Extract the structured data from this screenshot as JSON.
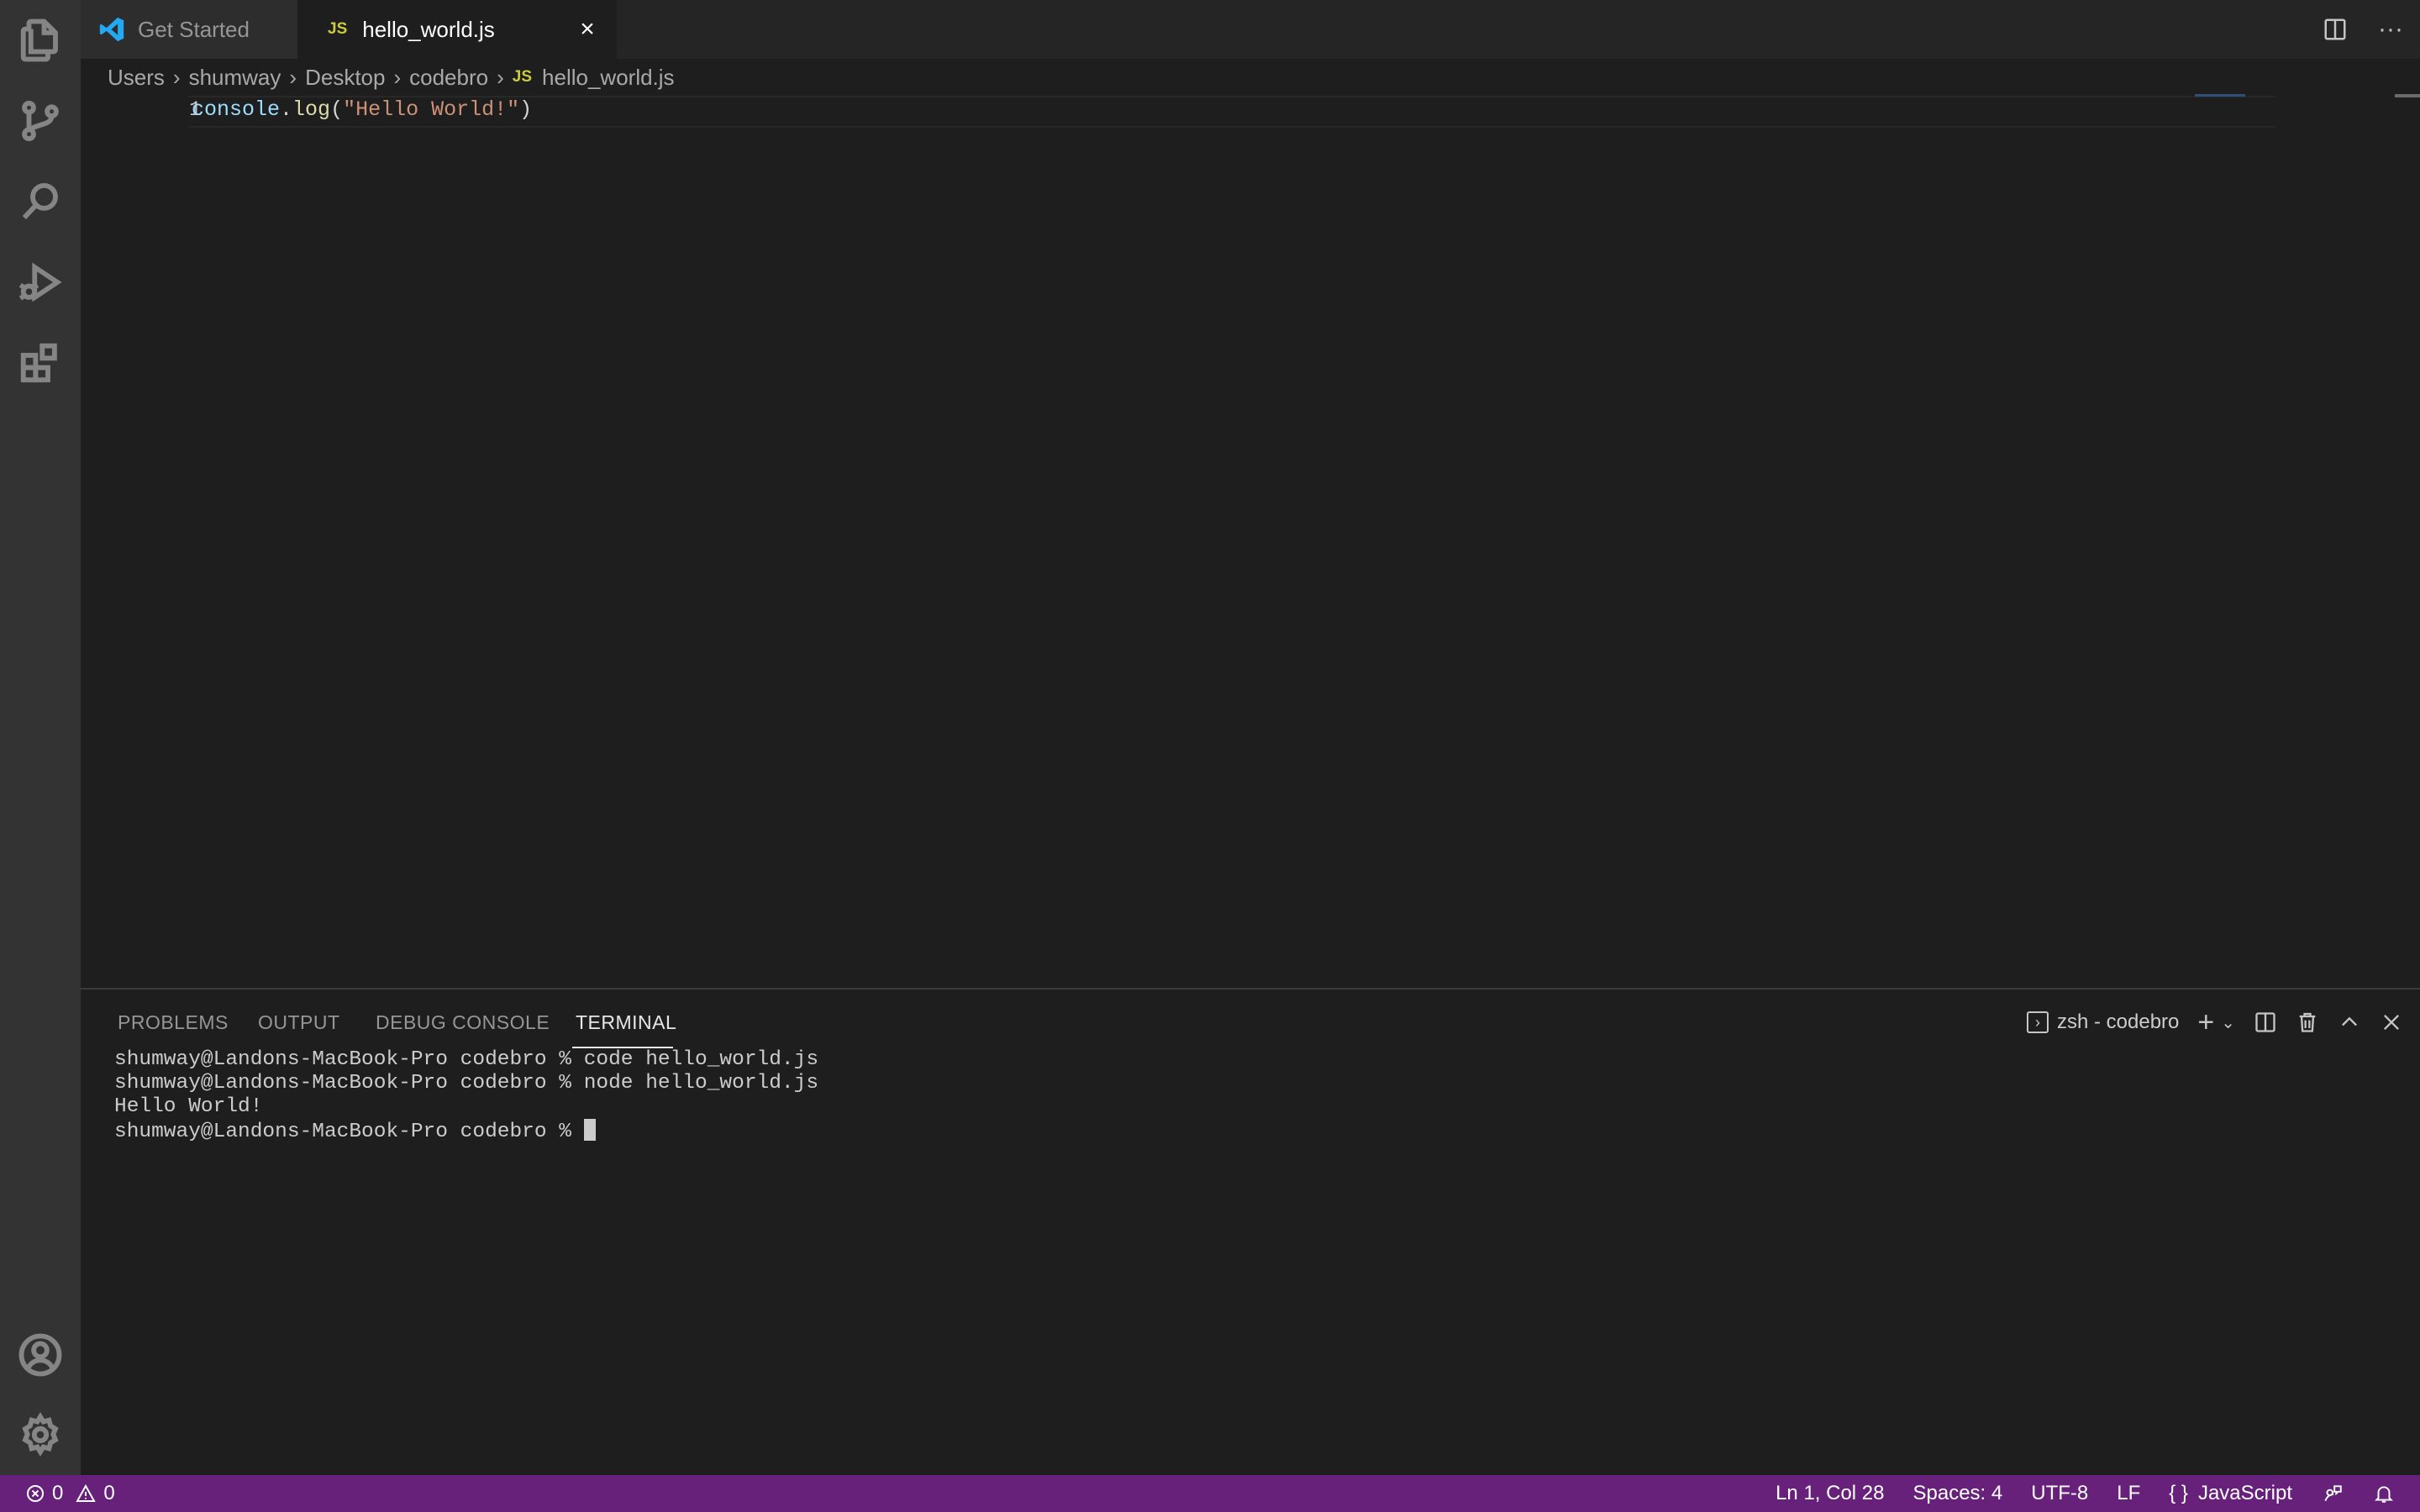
{
  "tabs": [
    {
      "label": "Get Started"
    },
    {
      "label": "hello_world.js",
      "badge": "JS"
    }
  ],
  "tabbar": {
    "close_glyph": "×",
    "more_glyph": "···"
  },
  "breadcrumb": [
    "Users",
    "shumway",
    "Desktop",
    "codebro",
    "hello_world.js"
  ],
  "breadcrumb_file_badge": "JS",
  "editor": {
    "line_number": "1",
    "code": {
      "obj": "console",
      "dot": ".",
      "fn": "log",
      "open": "(",
      "str": "\"Hello World!\"",
      "close": ")"
    }
  },
  "panel": {
    "tabs": [
      "PROBLEMS",
      "OUTPUT",
      "DEBUG CONSOLE",
      "TERMINAL"
    ],
    "terminal_name": "zsh - codebro",
    "terminal_lines": [
      "shumway@Landons-MacBook-Pro codebro % code hello_world.js",
      "shumway@Landons-MacBook-Pro codebro % node hello_world.js",
      "Hello World!",
      "shumway@Landons-MacBook-Pro codebro % "
    ]
  },
  "statusbar": {
    "errors": "0",
    "warnings": "0",
    "position": "Ln 1, Col 28",
    "spaces": "Spaces: 4",
    "encoding": "UTF-8",
    "eol": "LF",
    "language": "JavaScript"
  },
  "colors": {
    "statusbar": "#68217a",
    "activity_bar": "#333333",
    "editor_bg": "#1e1e1e",
    "js_badge": "#cbcb41"
  }
}
